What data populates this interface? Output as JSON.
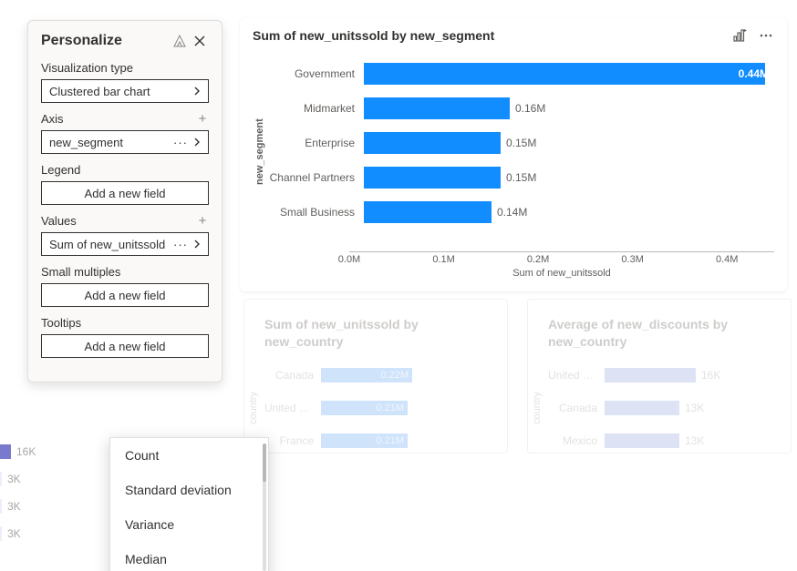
{
  "pane": {
    "title": "Personalize",
    "viz_type_label": "Visualization type",
    "viz_type_value": "Clustered bar chart",
    "axis_label": "Axis",
    "axis_value": "new_segment",
    "legend_label": "Legend",
    "values_label": "Values",
    "values_value": "Sum of new_unitssold",
    "small_multiples_label": "Small multiples",
    "tooltips_label": "Tooltips",
    "add_field": "Add a new field"
  },
  "main_chart": {
    "title": "Sum of new_unitssold by new_segment",
    "xlabel": "Sum of new_unitssold",
    "ylabel": "new_segment"
  },
  "chart_data": {
    "type": "bar",
    "title": "Sum of new_unitssold by new_segment",
    "ylabel": "new_segment",
    "xlabel": "Sum of new_unitssold",
    "xlim": [
      0,
      450000
    ],
    "ticks": [
      {
        "v": 0,
        "label": "0.0M"
      },
      {
        "v": 100000,
        "label": "0.1M"
      },
      {
        "v": 200000,
        "label": "0.2M"
      },
      {
        "v": 300000,
        "label": "0.3M"
      },
      {
        "v": 400000,
        "label": "0.4M"
      }
    ],
    "categories": [
      "Government",
      "Midmarket",
      "Enterprise",
      "Channel Partners",
      "Small Business"
    ],
    "values": [
      440000,
      160000,
      150000,
      150000,
      140000
    ],
    "value_labels": [
      "0.44M",
      "0.16M",
      "0.15M",
      "0.15M",
      "0.14M"
    ]
  },
  "faded_chart_1": {
    "title": "Sum of new_unitssold by new_country",
    "ylabel": "country",
    "rows": [
      {
        "label": "Canada",
        "value_label": "0.22M",
        "w": 100
      },
      {
        "label": "United St…",
        "value_label": "0.21M",
        "w": 95
      },
      {
        "label": "France",
        "value_label": "0.21M",
        "w": 95
      }
    ]
  },
  "faded_chart_2": {
    "title": "Average of new_discounts by new_country",
    "ylabel": "country",
    "rows": [
      {
        "label": "United St…",
        "value_label": "16K",
        "w": 100
      },
      {
        "label": "Canada",
        "value_label": "13K",
        "w": 82
      },
      {
        "label": "Mexico",
        "value_label": "13K",
        "w": 82
      }
    ]
  },
  "faded_left": {
    "rows": [
      {
        "w": 12,
        "label": "16K",
        "solid": true
      },
      {
        "w": 2,
        "label": "3K"
      },
      {
        "w": 2,
        "label": "3K"
      },
      {
        "w": 2,
        "label": "3K"
      }
    ]
  },
  "context_menu": {
    "items": [
      "Count",
      "Standard deviation",
      "Variance",
      "Median"
    ]
  },
  "colors": {
    "accent": "#118dff"
  }
}
